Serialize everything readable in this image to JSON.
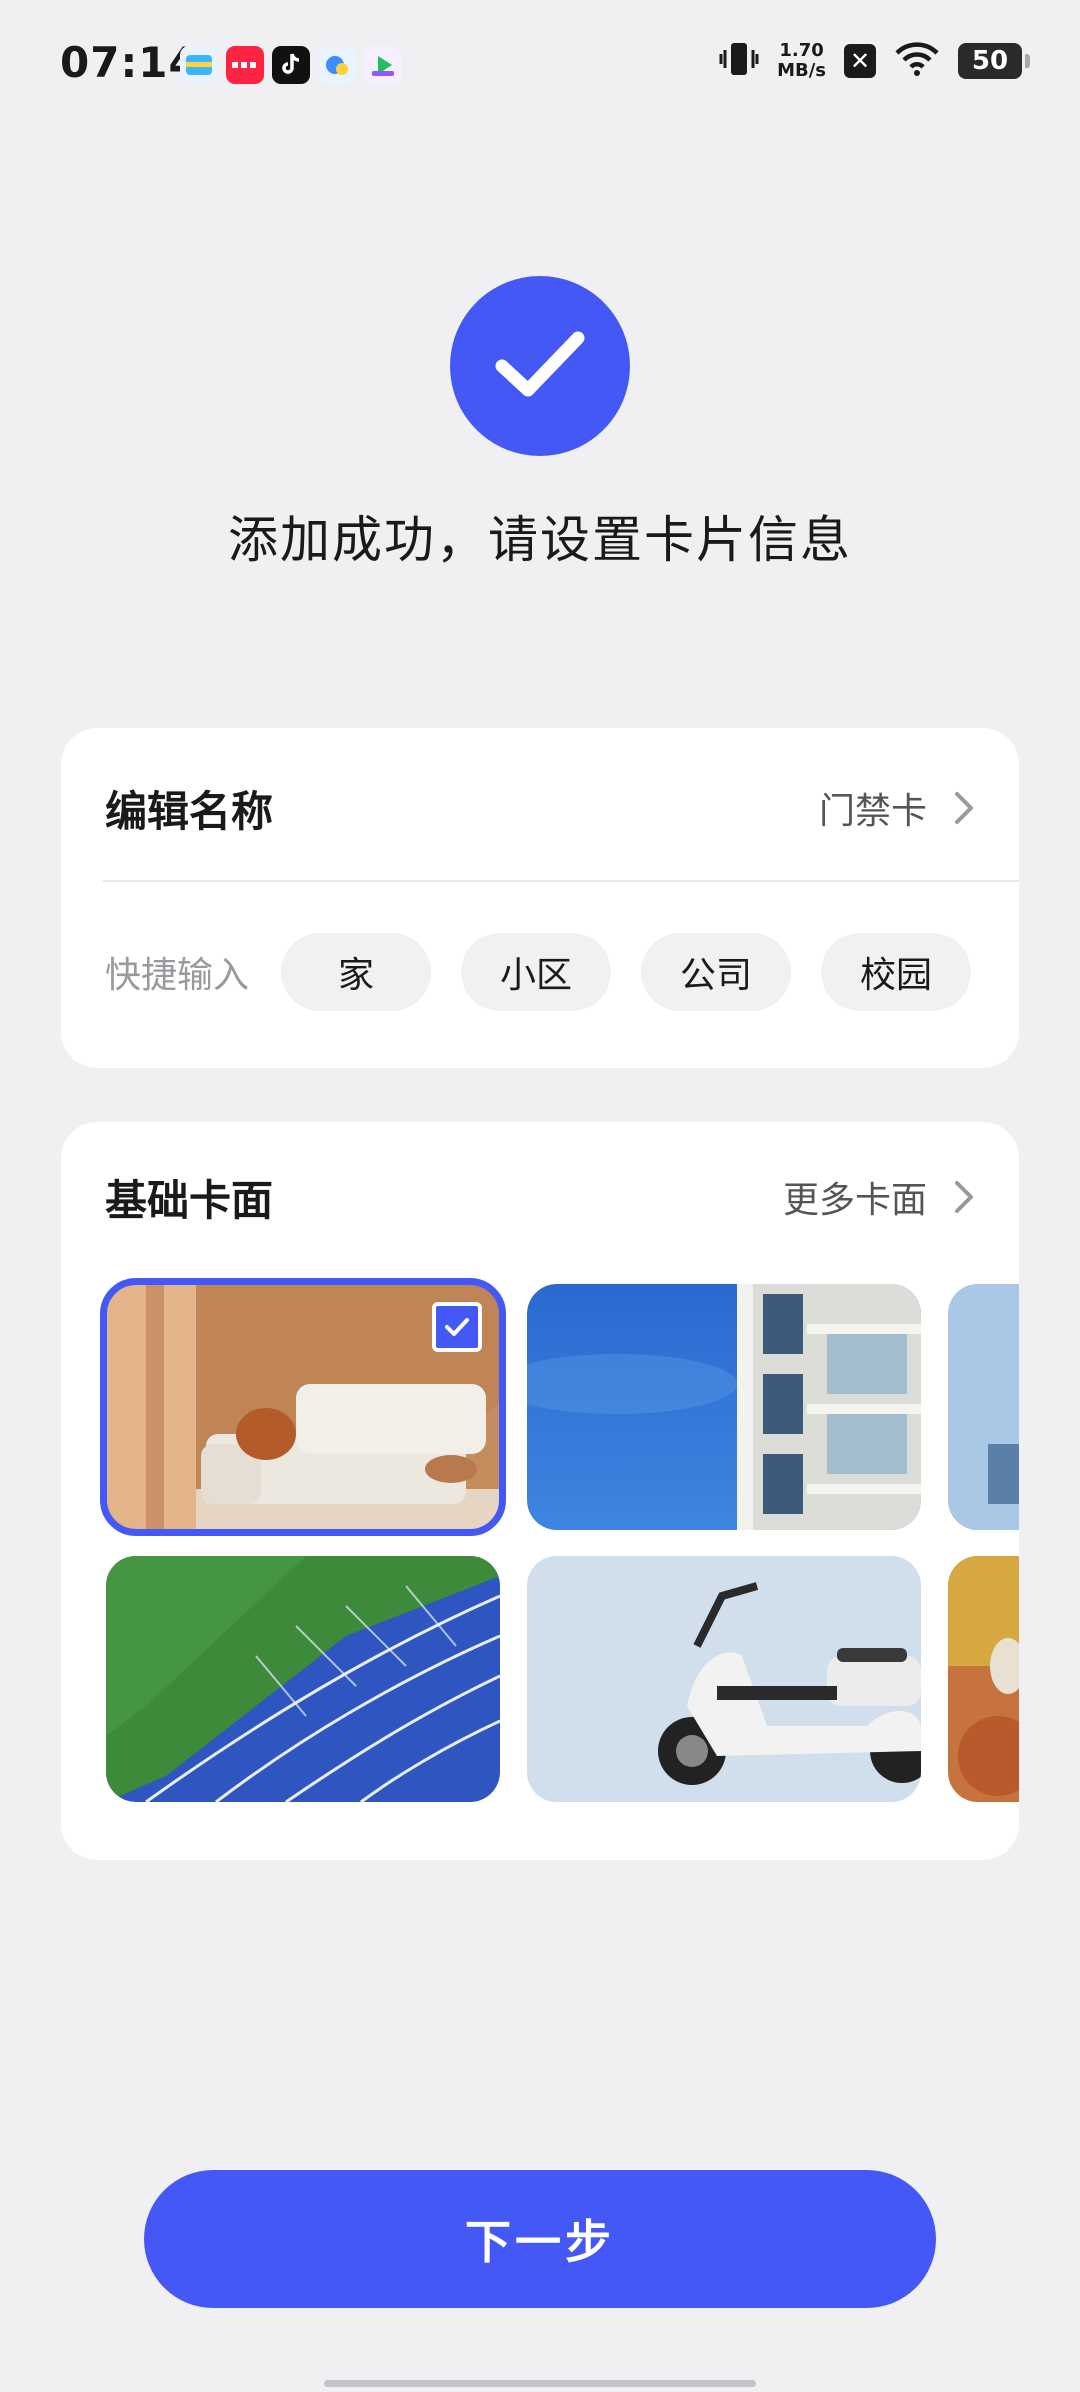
{
  "status_bar": {
    "time": "07:14",
    "net_speed_value": "1.70",
    "net_speed_unit": "MB/s",
    "battery": "50",
    "apps": [
      "wallet-app-icon",
      "xiaohongshu-app-icon",
      "douyin-app-icon",
      "files-app-icon",
      "video-app-icon"
    ]
  },
  "header": {
    "title": "添加成功，请设置卡片信息"
  },
  "name_card": {
    "label": "编辑名称",
    "value": "门禁卡",
    "quick_label": "快捷输入",
    "chips": [
      "家",
      "小区",
      "公司",
      "校园"
    ]
  },
  "face_card": {
    "label": "基础卡面",
    "more": "更多卡面",
    "faces": [
      {
        "icon": "living-room-image",
        "selected": true
      },
      {
        "icon": "building-image",
        "selected": false
      },
      {
        "icon": "building-partial-image",
        "selected": false
      },
      {
        "icon": "running-track-image",
        "selected": false
      },
      {
        "icon": "scooter-image",
        "selected": false
      },
      {
        "icon": "orange-partial-image",
        "selected": false
      }
    ]
  },
  "footer": {
    "next_label": "下一步"
  },
  "colors": {
    "accent": "#4458f5",
    "background": "#f0f0f3"
  }
}
